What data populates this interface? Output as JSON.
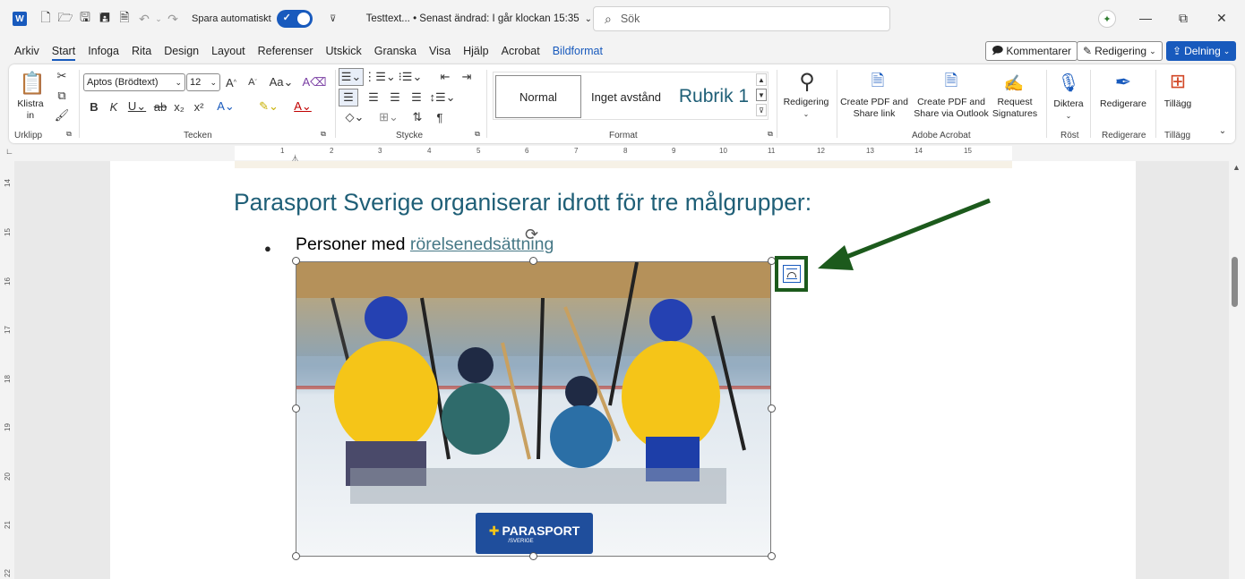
{
  "titlebar": {
    "autosave_label": "Spara automatiskt",
    "doc_title": "Testtext... • Senast ändrad: I går klockan 15:35",
    "search_placeholder": "Sök"
  },
  "menu": {
    "tabs": [
      "Arkiv",
      "Start",
      "Infoga",
      "Rita",
      "Design",
      "Layout",
      "Referenser",
      "Utskick",
      "Granska",
      "Visa",
      "Hjälp",
      "Acrobat",
      "Bildformat"
    ],
    "active": "Start",
    "comments": "Kommentarer",
    "editing": "Redigering",
    "share": "Delning"
  },
  "ribbon": {
    "clipboard": {
      "paste": "Klistra in",
      "group": "Urklipp"
    },
    "font": {
      "name": "Aptos (Brödtext)",
      "size": "12",
      "group": "Tecken"
    },
    "paragraph": {
      "group": "Stycke"
    },
    "styles": {
      "items": [
        "Normal",
        "Inget avstånd",
        "Rubrik 1"
      ],
      "group": "Format"
    },
    "editing": {
      "label": "Redigering"
    },
    "adobe": {
      "create_pdf": "Create PDF and Share link",
      "create_pdf_outlook": "Create PDF and Share via Outlook",
      "request": "Request Signatures",
      "group": "Adobe Acrobat"
    },
    "voice": {
      "dictate": "Diktera",
      "group": "Röst"
    },
    "editor": {
      "label": "Redigerare",
      "group": "Redigerare"
    },
    "addins": {
      "label": "Tillägg",
      "group": "Tillägg"
    }
  },
  "ruler": {
    "numbers": [
      "1",
      "2",
      "3",
      "4",
      "5",
      "6",
      "7",
      "8",
      "9",
      "10",
      "11",
      "12",
      "13",
      "14",
      "15"
    ]
  },
  "vruler": {
    "numbers": [
      "14",
      "15",
      "16",
      "17",
      "18",
      "19",
      "20",
      "21",
      "22"
    ]
  },
  "document": {
    "heading": "Parasport Sverige organiserar idrott för tre målgrupper:",
    "bullet_prefix": "Personer med ",
    "bullet_link": "rörelsenedsättning"
  },
  "image": {
    "logo_text": "PARASPORT",
    "logo_sub": "/SVERIGE"
  },
  "colors": {
    "accent": "#185abd",
    "heading": "#1f5f77",
    "annotation": "#1c5a1c"
  }
}
